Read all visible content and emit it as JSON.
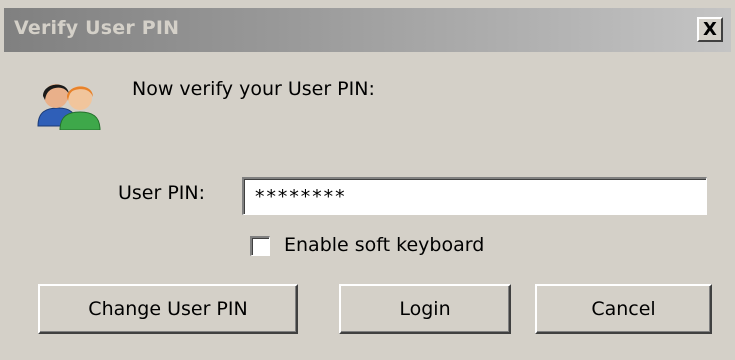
{
  "window": {
    "title": "Verify User PIN",
    "close_label": "X"
  },
  "icons": {
    "dialog_icon": "users-icon",
    "close": "close-icon"
  },
  "prompt": "Now verify your User PIN:",
  "pin_field": {
    "label": "User PIN:",
    "value": "********"
  },
  "soft_keyboard": {
    "label": "Enable soft keyboard",
    "checked": false
  },
  "buttons": {
    "change_pin": "Change User PIN",
    "login": "Login",
    "cancel": "Cancel"
  },
  "colors": {
    "dialog_bg": "#d4d0c8",
    "titlebar_inactive": "#808080"
  }
}
